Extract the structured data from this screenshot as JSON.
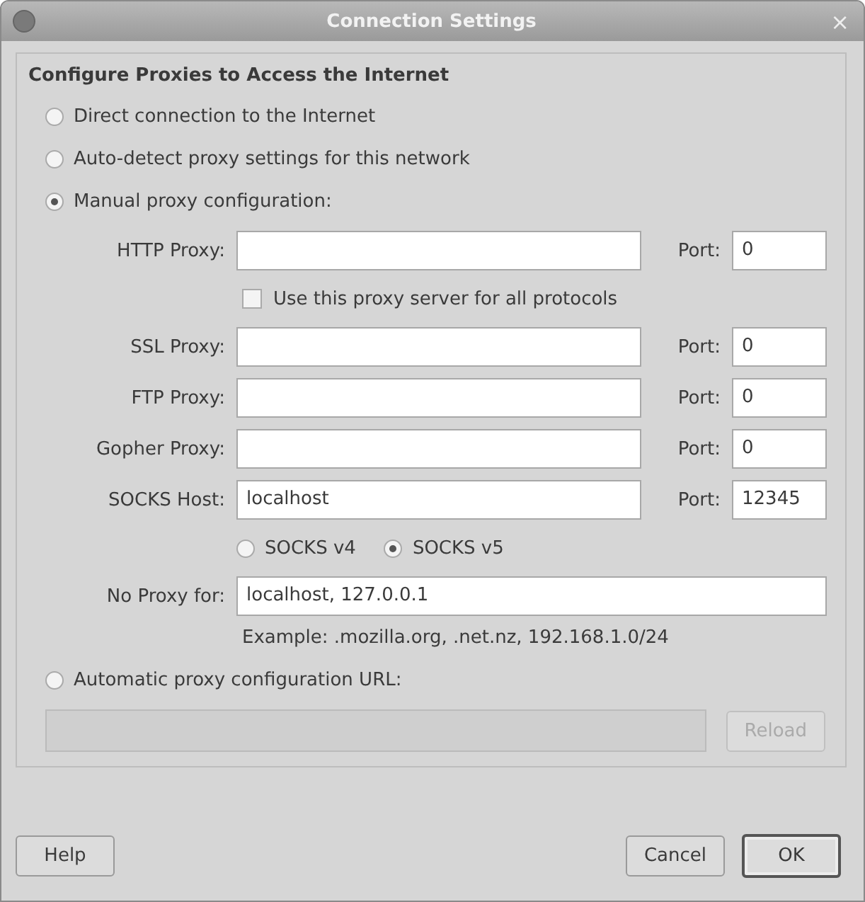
{
  "window": {
    "title": "Connection Settings",
    "close": "×"
  },
  "group": {
    "title": "Configure Proxies to Access the Internet"
  },
  "modes": [
    {
      "label": "Direct connection to the Internet",
      "selected": false
    },
    {
      "label": "Auto-detect proxy settings for this network",
      "selected": false
    },
    {
      "label": "Manual proxy configuration:",
      "selected": true
    },
    {
      "label": "Automatic proxy configuration URL:",
      "selected": false
    }
  ],
  "proxies": [
    {
      "label": "HTTP Proxy:",
      "port_label": "Port:",
      "port": "0"
    },
    {
      "label": "SSL Proxy:",
      "port_label": "Port:",
      "port": "0"
    },
    {
      "label": "FTP Proxy:",
      "port_label": "Port:",
      "port": "0"
    },
    {
      "label": "Gopher Proxy:",
      "port_label": "Port:",
      "port": "0"
    },
    {
      "label": "SOCKS Host:",
      "value": "localhost",
      "port_label": "Port:",
      "port": "12345"
    }
  ],
  "share_all": {
    "label": "Use this proxy server for all protocols",
    "checked": false
  },
  "socks_versions": [
    {
      "label": "SOCKS v4",
      "selected": false
    },
    {
      "label": "SOCKS v5",
      "selected": true
    }
  ],
  "no_proxy": {
    "label": "No Proxy for:",
    "value": "localhost, 127.0.0.1"
  },
  "example": "Example: .mozilla.org, .net.nz, 192.168.1.0/24",
  "pac_url": {
    "disabled": true
  },
  "reload": {
    "label": "Reload",
    "disabled": true
  },
  "buttons": [
    {
      "label": "Help",
      "default": false
    },
    {
      "label": "Cancel",
      "default": false
    },
    {
      "label": "OK",
      "default": true
    }
  ]
}
